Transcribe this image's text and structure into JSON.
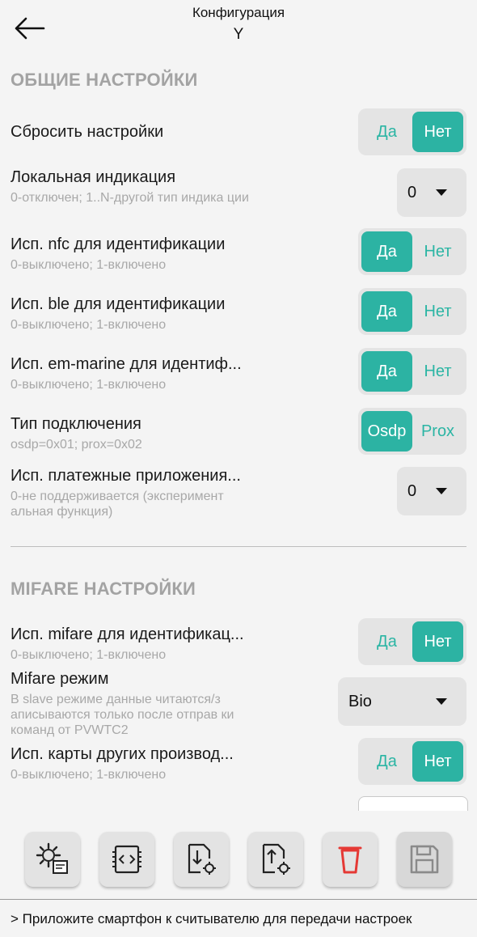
{
  "header": {
    "title": "Конфигурация",
    "subtitle": "Y"
  },
  "sections": {
    "general": {
      "title": "ОБЩИЕ НАСТРОЙКИ"
    },
    "mifare": {
      "title": "MIFARE НАСТРОЙКИ"
    }
  },
  "rows": {
    "reset": {
      "label": "Сбросить настройки",
      "options": [
        "Да",
        "Нет"
      ],
      "selected": "Нет"
    },
    "local_indication": {
      "label": "Локальная индикация",
      "desc": "0-отключен; 1..N-другой тип индика ции",
      "value": "0"
    },
    "nfc": {
      "label": "Исп. nfc для идентификации",
      "desc": "0-выключено; 1-включено",
      "options": [
        "Да",
        "Нет"
      ],
      "selected": "Да"
    },
    "ble": {
      "label": "Исп. ble для идентификации",
      "desc": "0-выключено; 1-включено",
      "options": [
        "Да",
        "Нет"
      ],
      "selected": "Да"
    },
    "em_marine": {
      "label": "Исп. em-marine для идентиф...",
      "desc": "0-выключено; 1-включено",
      "options": [
        "Да",
        "Нет"
      ],
      "selected": "Да"
    },
    "connection": {
      "label": "Тип подключения",
      "desc": "osdp=0x01; prox=0x02",
      "options": [
        "Osdp",
        "Prox"
      ],
      "selected": "Osdp"
    },
    "payment": {
      "label": "Исп. платежные приложения...",
      "desc": "0-не поддерживается (эксперимент альная функция)",
      "value": "0"
    },
    "mifare_id": {
      "label": "Исп. mifare для идентификац...",
      "desc": "0-выключено; 1-включено",
      "options": [
        "Да",
        "Нет"
      ],
      "selected": "Нет"
    },
    "mifare_mode": {
      "label": "Mifare режим",
      "desc": "В slave режиме данные читаются/з аписываются только после отправ ки команд от PVWTC2",
      "value": "Bio"
    },
    "other_cards": {
      "label": "Исп. карты других производ...",
      "desc": "0-выключено; 1-включено",
      "options": [
        "Да",
        "Нет"
      ],
      "selected": "Нет"
    }
  },
  "toolbar": {
    "buttons": [
      "settings-config-icon",
      "code-chip-icon",
      "download-settings-icon",
      "upload-settings-icon",
      "trash-icon",
      "save-icon"
    ]
  },
  "status": {
    "text": "> Приложите смартфон к считывателю для передачи настроек"
  },
  "colors": {
    "accent": "#2cb3a3",
    "toggle_bg": "#e4e4e4",
    "trash": "#e53935",
    "section_title": "#a3a3a3"
  }
}
